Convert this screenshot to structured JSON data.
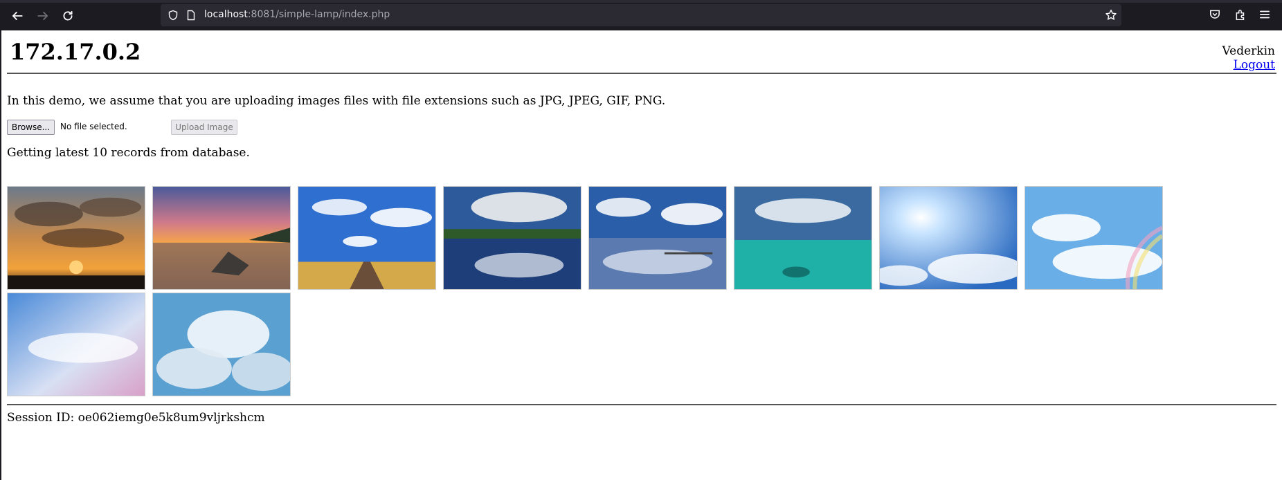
{
  "browser": {
    "url_host": "localhost",
    "url_rest": ":8081/simple-lamp/index.php",
    "icons": [
      "back-icon",
      "forward-icon",
      "reload-icon",
      "shield-icon",
      "page-icon",
      "bookmark-star-icon",
      "pocket-icon",
      "extensions-icon",
      "menu-icon"
    ]
  },
  "header": {
    "title": "172.17.0.2",
    "username": "Vederkin",
    "logout_label": "Logout"
  },
  "intro_text": "In this demo, we assume that you are uploading images files with file extensions such as JPG, JPEG, GIF, PNG.",
  "upload": {
    "browse_label": "Browse...",
    "no_file_text": "No file selected.",
    "upload_label": "Upload Image"
  },
  "records_text": "Getting latest 10 records from database.",
  "gallery": {
    "images": [
      {
        "name": "sunset-clouds-city"
      },
      {
        "name": "sunset-beach-rock"
      },
      {
        "name": "road-blue-sky"
      },
      {
        "name": "lake-reflection-clouds"
      },
      {
        "name": "pier-cloud-reflection"
      },
      {
        "name": "turquoise-sea-clouds"
      },
      {
        "name": "sun-rays-sky"
      },
      {
        "name": "rainbow-clouds"
      },
      {
        "name": "pastel-cloudscape"
      },
      {
        "name": "cumulus-clouds"
      }
    ]
  },
  "session": {
    "text": "Session ID: oe062iemg0e5k8um9vljrkshcm"
  }
}
